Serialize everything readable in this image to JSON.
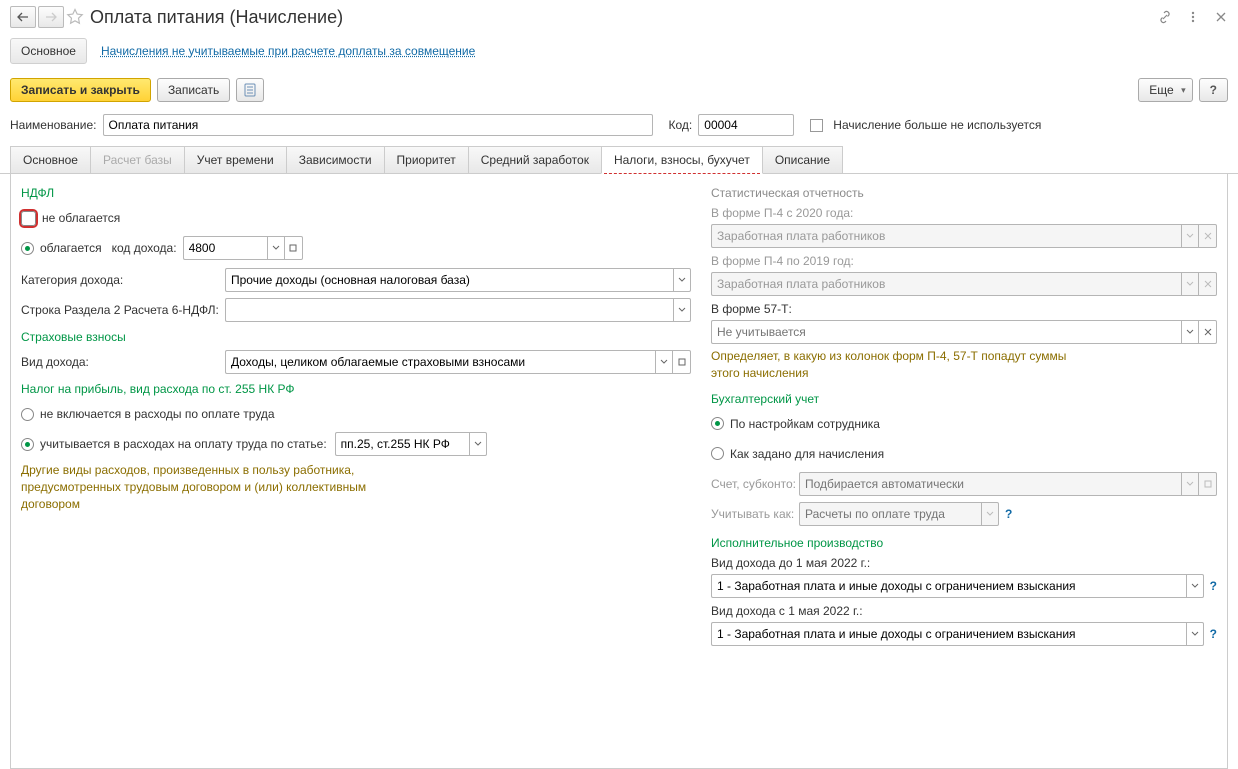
{
  "header": {
    "title": "Оплата питания (Начисление)"
  },
  "navlinks": {
    "main": "Основное",
    "link1": "Начисления не учитываемые при расчете доплаты за совмещение"
  },
  "toolbar": {
    "save_close": "Записать и закрыть",
    "save": "Записать",
    "more": "Еще",
    "help": "?"
  },
  "fields": {
    "name_label": "Наименование:",
    "name_value": "Оплата питания",
    "code_label": "Код:",
    "code_value": "00004",
    "not_used_label": "Начисление больше не используется"
  },
  "tabs": {
    "t0": "Основное",
    "t1": "Расчет базы",
    "t2": "Учет времени",
    "t3": "Зависимости",
    "t4": "Приоритет",
    "t5": "Средний заработок",
    "t6": "Налоги, взносы, бухучет",
    "t7": "Описание"
  },
  "left": {
    "ndfl_title": "НДФЛ",
    "not_taxed": "не облагается",
    "taxed": "облагается",
    "code_label": "код дохода:",
    "code_value": "4800",
    "cat_label": "Категория дохода:",
    "cat_value": "Прочие доходы (основная налоговая база)",
    "row6_label": "Строка Раздела 2 Расчета 6-НДФЛ:",
    "ins_title": "Страховые взносы",
    "income_type_label": "Вид дохода:",
    "income_type_value": "Доходы, целиком облагаемые страховыми взносами",
    "profit_title": "Налог на прибыль, вид расхода по ст. 255 НК РФ",
    "not_included": "не включается в расходы по оплате труда",
    "included": "учитывается в расходах на оплату труда по статье:",
    "article_value": "пп.25, ст.255 НК РФ",
    "note": "Другие виды расходов, произведенных в пользу работника, предусмотренных трудовым договором и (или) коллективным договором"
  },
  "right": {
    "stat_title": "Статистическая отчетность",
    "p4_2020": "В форме П-4 с 2020 года:",
    "p4_2020_val": "Заработная плата работников",
    "p4_2019": "В форме П-4 по 2019 год:",
    "p4_2019_val": "Заработная плата работников",
    "t57": "В форме 57-Т:",
    "t57_ph": "Не учитывается",
    "stat_note": "Определяет, в какую из колонок форм П-4, 57-Т попадут суммы этого начисления",
    "accounting_title": "Бухгалтерский учет",
    "by_employee": "По настройкам сотрудника",
    "by_accrual": "Как задано для начисления",
    "acct_label": "Счет, субконто:",
    "acct_ph": "Подбирается автоматически",
    "treat_label": "Учитывать как:",
    "treat_ph": "Расчеты по оплате труда",
    "exec_title": "Исполнительное производство",
    "income_before_label": "Вид дохода до 1 мая 2022 г.:",
    "income_before_val": "1 - Заработная плата и иные доходы с ограничением взыскания",
    "income_after_label": "Вид дохода с 1 мая 2022 г.:",
    "income_after_val": "1 - Заработная плата и иные доходы с ограничением взыскания"
  }
}
